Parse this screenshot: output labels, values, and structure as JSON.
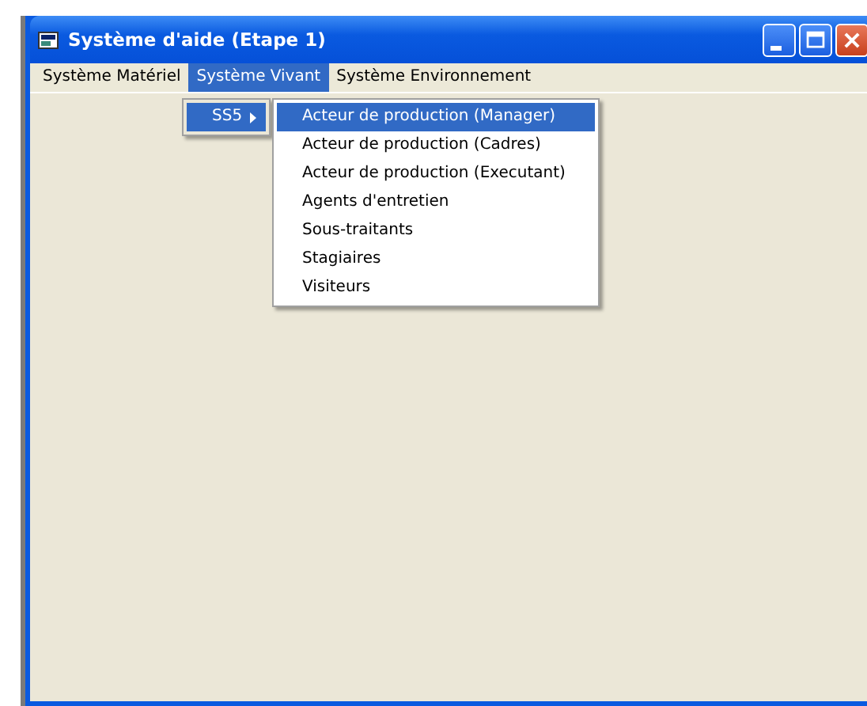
{
  "window": {
    "title": "Système d'aide (Etape 1)"
  },
  "menu_bar": [
    {
      "label": "Système Matériel",
      "selected": false
    },
    {
      "label": "Système Vivant",
      "selected": true
    },
    {
      "label": "Système Environnement",
      "selected": false
    }
  ],
  "submenu": [
    {
      "label": "SS5",
      "selected": true,
      "has_submenu": true
    }
  ],
  "nested_submenu": [
    {
      "label": "Acteur de production (Manager)",
      "selected": true
    },
    {
      "label": "Acteur de production (Cadres)",
      "selected": false
    },
    {
      "label": "Acteur de production (Executant)",
      "selected": false
    },
    {
      "label": "Agents d'entretien",
      "selected": false
    },
    {
      "label": "Sous-traitants",
      "selected": false
    },
    {
      "label": "Stagiaires",
      "selected": false
    },
    {
      "label": "Visiteurs",
      "selected": false
    }
  ]
}
